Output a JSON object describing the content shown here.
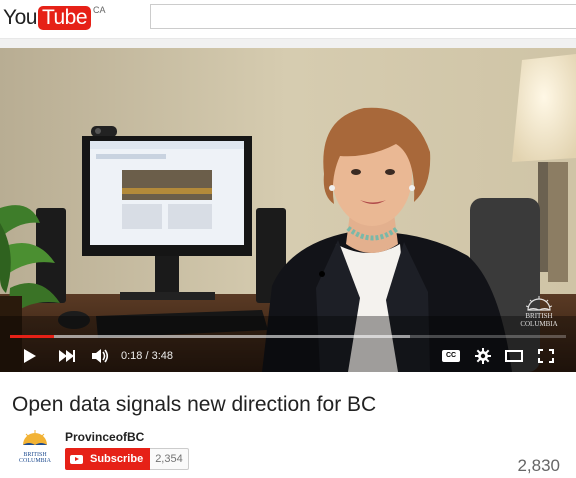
{
  "masthead": {
    "logo_you": "You",
    "logo_tube": "Tube",
    "country": "CA",
    "search_placeholder": ""
  },
  "player": {
    "time_current": "0:18",
    "time_separator": " / ",
    "time_total": "3:48",
    "played_fraction": 0.079,
    "buffered_fraction": 0.72,
    "cc_label": "CC",
    "watermark": [
      "BRITISH",
      "COLUMBIA"
    ],
    "icons": [
      "play-icon",
      "next-icon",
      "volume-icon",
      "captions-icon",
      "settings-icon",
      "theater-mode-icon",
      "fullscreen-icon"
    ]
  },
  "video": {
    "title": "Open data signals new direction for BC"
  },
  "channel": {
    "name": "ProvinceofBC",
    "avatar_text": [
      "BRITISH",
      "COLUMBIA"
    ],
    "subscribe_label": "Subscribe",
    "subscriber_count": "2,354"
  },
  "stats": {
    "view_count": "2,830"
  },
  "colors": {
    "brand_red": "#e62117",
    "text": "#222222",
    "muted": "#666666"
  }
}
